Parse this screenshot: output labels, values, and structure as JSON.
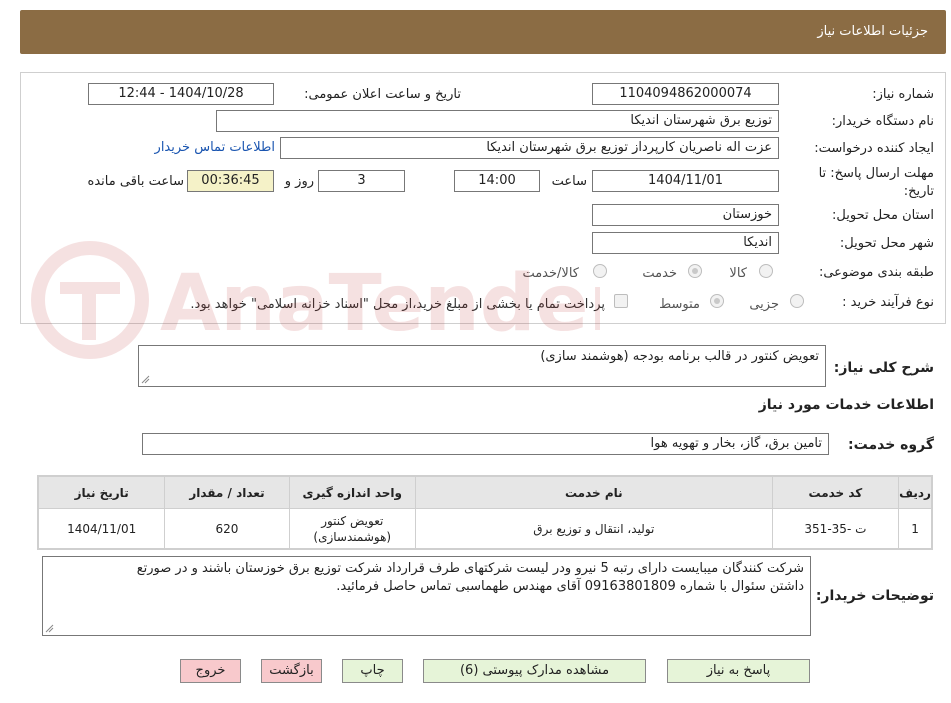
{
  "header": {
    "title": "جزئیات اطلاعات نیاز"
  },
  "form": {
    "need_number_label": "شماره نیاز:",
    "need_number": "1104094862000074",
    "announce_label": "تاریخ و ساعت اعلان عمومی:",
    "announce_value": "1404/10/28 - 12:44",
    "buyer_org_label": "نام دستگاه خریدار:",
    "buyer_org": "توزیع برق شهرستان اندیکا",
    "creator_label": "ایجاد کننده درخواست:",
    "creator": "عزت اله ناصریان کارپرداز توزیع برق شهرستان اندیکا",
    "contact_link": "اطلاعات تماس خریدار",
    "deadline_label_line1": "مهلت ارسال پاسخ: تا",
    "deadline_label_line2": "تاریخ:",
    "deadline_date": "1404/11/01",
    "time_label": "ساعت",
    "deadline_time": "14:00",
    "days_value": "3",
    "days_label": "روز و",
    "remaining_time": "00:36:45",
    "remaining_label": "ساعت باقی مانده",
    "province_label": "استان محل تحویل:",
    "province": "خوزستان",
    "city_label": "شهر محل تحویل:",
    "city": "اندیکا",
    "category_label": "طبقه بندی موضوعی:",
    "category_options": [
      "کالا",
      "خدمت",
      "کالا/خدمت"
    ],
    "process_label": "نوع فرآیند خرید :",
    "process_options": [
      "جزیی",
      "متوسط"
    ],
    "treasury_note": "پرداخت تمام یا بخشی از مبلغ خرید،از محل \"اسناد خزانه اسلامی\" خواهد بود."
  },
  "summary": {
    "label": "شرح کلی نیاز:",
    "value": "تعویض کنتور در قالب برنامه بودجه (هوشمند سازی)"
  },
  "services": {
    "title": "اطلاعات خدمات مورد نیاز",
    "group_label": "گروه خدمت:",
    "group_value": "تامین برق، گاز، بخار و تهویه هوا"
  },
  "table": {
    "headers": [
      "ردیف",
      "کد خدمت",
      "نام خدمت",
      "واحد اندازه گیری",
      "تعداد / مقدار",
      "تاریخ نیاز"
    ],
    "rows": [
      {
        "row": "1",
        "code": "ت -35-351",
        "name": "تولید، انتقال و توزیع برق",
        "unit_line1": "تعویض کنتور",
        "unit_line2": "(هوشمندسازی)",
        "qty": "620",
        "date": "1404/11/01"
      }
    ]
  },
  "buyer_notes": {
    "label": "توضیحات خریدار:",
    "line1": "شرکت کنندگان میبایست دارای رتبه 5 نیرو  ودر لیست شرکتهای طرف قرارداد شرکت توزیع برق خوزستان باشند و در صورتع",
    "line2": "داشتن سئوال با شماره 09163801809 آقای مهندس طهماسبی تماس حاصل فرمائید."
  },
  "buttons": {
    "reply": "پاسخ به نیاز",
    "attachments": "مشاهده مدارک پیوستی (6)",
    "print": "چاپ",
    "back": "بازگشت",
    "exit": "خروج"
  },
  "watermark": {
    "text": "AnaTender.net"
  },
  "colors": {
    "header_bg": "#8b6c44",
    "link": "#1a55b0",
    "green_button": "#e6f4d8",
    "pink_button": "#f8c9cc",
    "remaining_bg": "#f5f2c8"
  }
}
